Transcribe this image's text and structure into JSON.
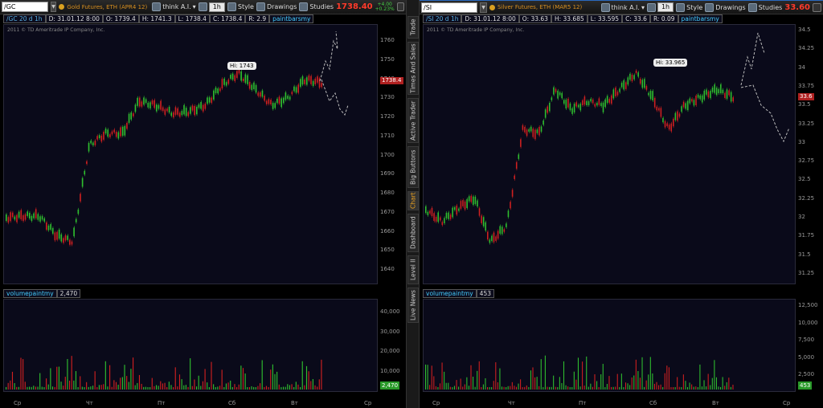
{
  "left": {
    "symbol": "/GC",
    "description": "Gold Futures, ETH (APR4 12)",
    "app_label": "think A.I.",
    "timeframe": "1h",
    "style_label": "Style",
    "drawings_label": "Drawings",
    "studies_label": "Studies",
    "last_price": "1738.40",
    "change_abs": "+4.00",
    "change_pct": "+0.23%",
    "info": {
      "sym": "/GC 20 d 1h",
      "date": "D: 31.01.12 8:00",
      "open": "O: 1739.4",
      "high": "H: 1741.3",
      "low": "L: 1738.4",
      "close": "C: 1738.4",
      "range": "R: 2.9",
      "study": "paintbarsmy"
    },
    "copyright": "2011 © TD Ameritrade IP Company, Inc.",
    "y_ticks": [
      "1760",
      "1750",
      "1740",
      "1730",
      "1720",
      "1710",
      "1700",
      "1690",
      "1680",
      "1670",
      "1660",
      "1650",
      "1640"
    ],
    "current_price_tag": "1738.4",
    "hi_label": "Hi: 1743",
    "volume_study": "volumepaintmy",
    "volume_value": "2,470",
    "vol_ticks": [
      "40,000",
      "30,000",
      "20,000",
      "10,000"
    ],
    "volume_tag": "2,470",
    "x_labels": [
      "Ср",
      "Чт",
      "Пт",
      "Сб",
      "Вт",
      "Ср"
    ]
  },
  "right": {
    "symbol": "/SI",
    "description": "Silver Futures, ETH (MAR5 12)",
    "app_label": "think A.I.",
    "timeframe": "1h",
    "style_label": "Style",
    "drawings_label": "Drawings",
    "studies_label": "Studies",
    "last_price": "33.60",
    "info": {
      "sym": "/SI 20 d 1h",
      "date": "D: 31.01.12 8:00",
      "open": "O: 33.63",
      "high": "H: 33.685",
      "low": "L: 33.595",
      "close": "C: 33.6",
      "range": "R: 0.09",
      "study": "paintbarsmy"
    },
    "copyright": "2011 © TD Ameritrade IP Company, Inc.",
    "y_ticks": [
      "34.5",
      "34.25",
      "34",
      "33.75",
      "33.5",
      "33.25",
      "33",
      "32.75",
      "32.5",
      "32.25",
      "32",
      "31.75",
      "31.5",
      "31.25"
    ],
    "current_price_tag": "33.6",
    "hi_label": "Hi: 33.965",
    "volume_study": "volumepaintmy",
    "volume_value": "453",
    "vol_ticks": [
      "12,500",
      "10,000",
      "7,500",
      "5,000",
      "2,500"
    ],
    "volume_tag": "453",
    "x_labels": [
      "Ср",
      "Чт",
      "Пт",
      "Сб",
      "Вт",
      "Ср"
    ]
  },
  "sidebar": {
    "tabs": [
      "Trade",
      "Times And Sales",
      "Active Trader",
      "Big Buttons",
      "Chart",
      "Dashboard",
      "Level II",
      "Live News"
    ],
    "active": "Chart"
  },
  "colors": {
    "up": "#2fbf2f",
    "down": "#d02020",
    "background": "#0a0a1a",
    "accent": "#e8a020"
  }
}
